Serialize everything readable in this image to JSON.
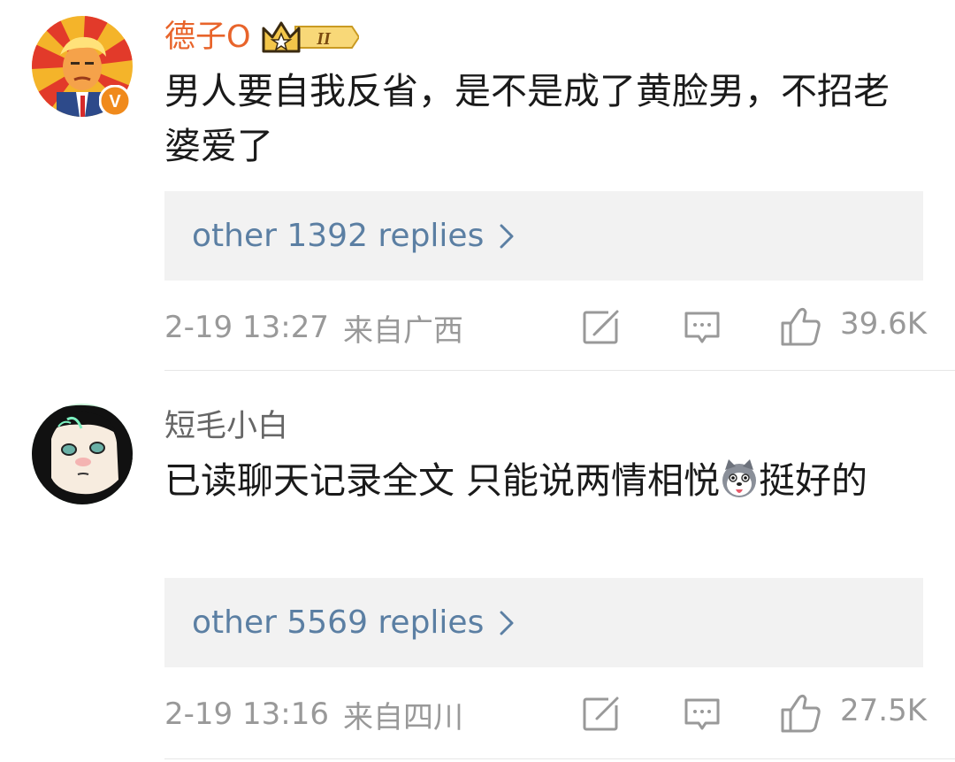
{
  "comments": [
    {
      "username": "德子O",
      "username_color": "#e8642b",
      "vip_level": "II",
      "verified_badge": "V",
      "text": "男人要自我反省，是不是成了黄脸男，不招老婆爱了",
      "replies_label": "other 1392 replies",
      "timestamp": "2-19 13:27",
      "location": "来自广西",
      "likes": "39.6K",
      "icons": [
        "share-icon",
        "reply-icon",
        "like-icon",
        "chevron-right-icon"
      ]
    },
    {
      "username": "短毛小白",
      "username_color": "#666666",
      "text_before_emoji": "已读聊天记录全文 只能说两情相悦",
      "emoji": "husky-emoji",
      "text_after_emoji": "挺好的",
      "replies_label": "other 5569 replies",
      "timestamp": "2-19 13:16",
      "location": "来自四川",
      "likes": "27.5K",
      "icons": [
        "share-icon",
        "reply-icon",
        "like-icon",
        "chevron-right-icon"
      ]
    }
  ],
  "colors": {
    "reply_link": "#5b7fa3",
    "meta_text": "#999999",
    "reply_box_bg": "#f2f2f2",
    "vip_gold": "#f3c64a"
  }
}
